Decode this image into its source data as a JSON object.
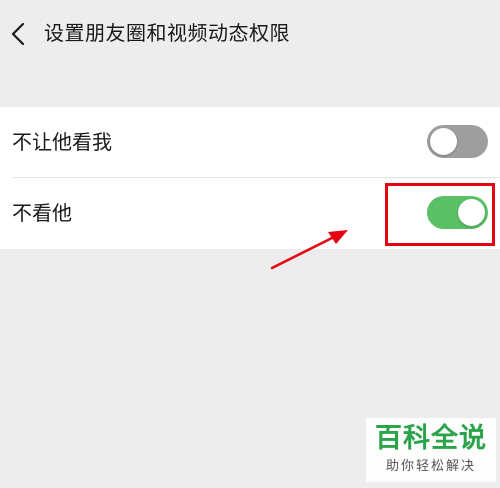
{
  "header": {
    "title": "设置朋友圈和视频动态权限",
    "back_icon": "chevron-left-icon"
  },
  "settings": {
    "items": [
      {
        "label": "不让他看我",
        "enabled": false
      },
      {
        "label": "不看他",
        "enabled": true
      }
    ]
  },
  "colors": {
    "toggle_on": "#5ac065",
    "toggle_off": "#9e9e9e",
    "annotation": "#e60012",
    "watermark": "#2aa34a"
  },
  "watermark": {
    "title": "百科全说",
    "subtitle": "助你轻松解决"
  }
}
